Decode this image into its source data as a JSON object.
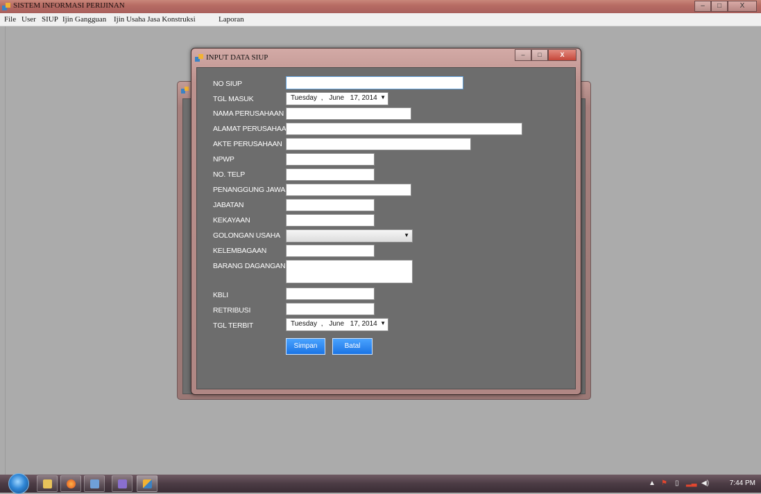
{
  "app": {
    "title": "SISTEM INFORMASI PERIJINAN",
    "window_controls": {
      "minimize": "–",
      "maximize": "□",
      "close": "X"
    }
  },
  "menu": [
    "File",
    "User",
    "SIUP",
    "Ijin Gangguan",
    "Ijin Usaha Jasa Konstruksi",
    "Laporan"
  ],
  "dialog": {
    "title": "INPUT DATA SIUP",
    "fields": {
      "no_siup": {
        "label": "NO SIUP",
        "value": ""
      },
      "tgl_masuk": {
        "label": "TGL MASUK",
        "day": "Tuesday",
        "sep": ",",
        "month": "June",
        "date": "17, 2014"
      },
      "nama_perusahaan": {
        "label": "NAMA PERUSAHAAN",
        "value": ""
      },
      "alamat_perusahaan": {
        "label": "ALAMAT PERUSAHAAN",
        "value": ""
      },
      "akte_perusahaan": {
        "label": "AKTE PERUSAHAAN",
        "value": ""
      },
      "npwp": {
        "label": "NPWP",
        "value": ""
      },
      "no_telp": {
        "label": "NO. TELP",
        "value": ""
      },
      "penanggung_jawab": {
        "label": "PENANGGUNG JAWAB",
        "value": ""
      },
      "jabatan": {
        "label": "JABATAN",
        "value": ""
      },
      "kekayaan": {
        "label": "KEKAYAAN",
        "value": ""
      },
      "golongan_usaha": {
        "label": "GOLONGAN USAHA",
        "value": ""
      },
      "kelembagaan": {
        "label": "KELEMBAGAAN",
        "value": ""
      },
      "barang_dagangan": {
        "label": "BARANG DAGANGAN",
        "value": ""
      },
      "kbli": {
        "label": "KBLI",
        "value": ""
      },
      "retribusi": {
        "label": "RETRIBUSI",
        "value": ""
      },
      "tgl_terbit": {
        "label": "TGL TERBIT",
        "day": "Tuesday",
        "sep": ",",
        "month": "June",
        "date": "17, 2014"
      }
    },
    "buttons": {
      "save": "Simpan",
      "cancel": "Batal"
    }
  },
  "taskbar": {
    "clock": "7:44 PM",
    "buttons": [
      "explorer",
      "firefox",
      "app-window",
      "app-window-2",
      "app-active"
    ]
  },
  "colors": {
    "dialog_body": "#6d6d6d",
    "button_blue": "#1b74e4",
    "mdi_bg": "#ababab"
  }
}
